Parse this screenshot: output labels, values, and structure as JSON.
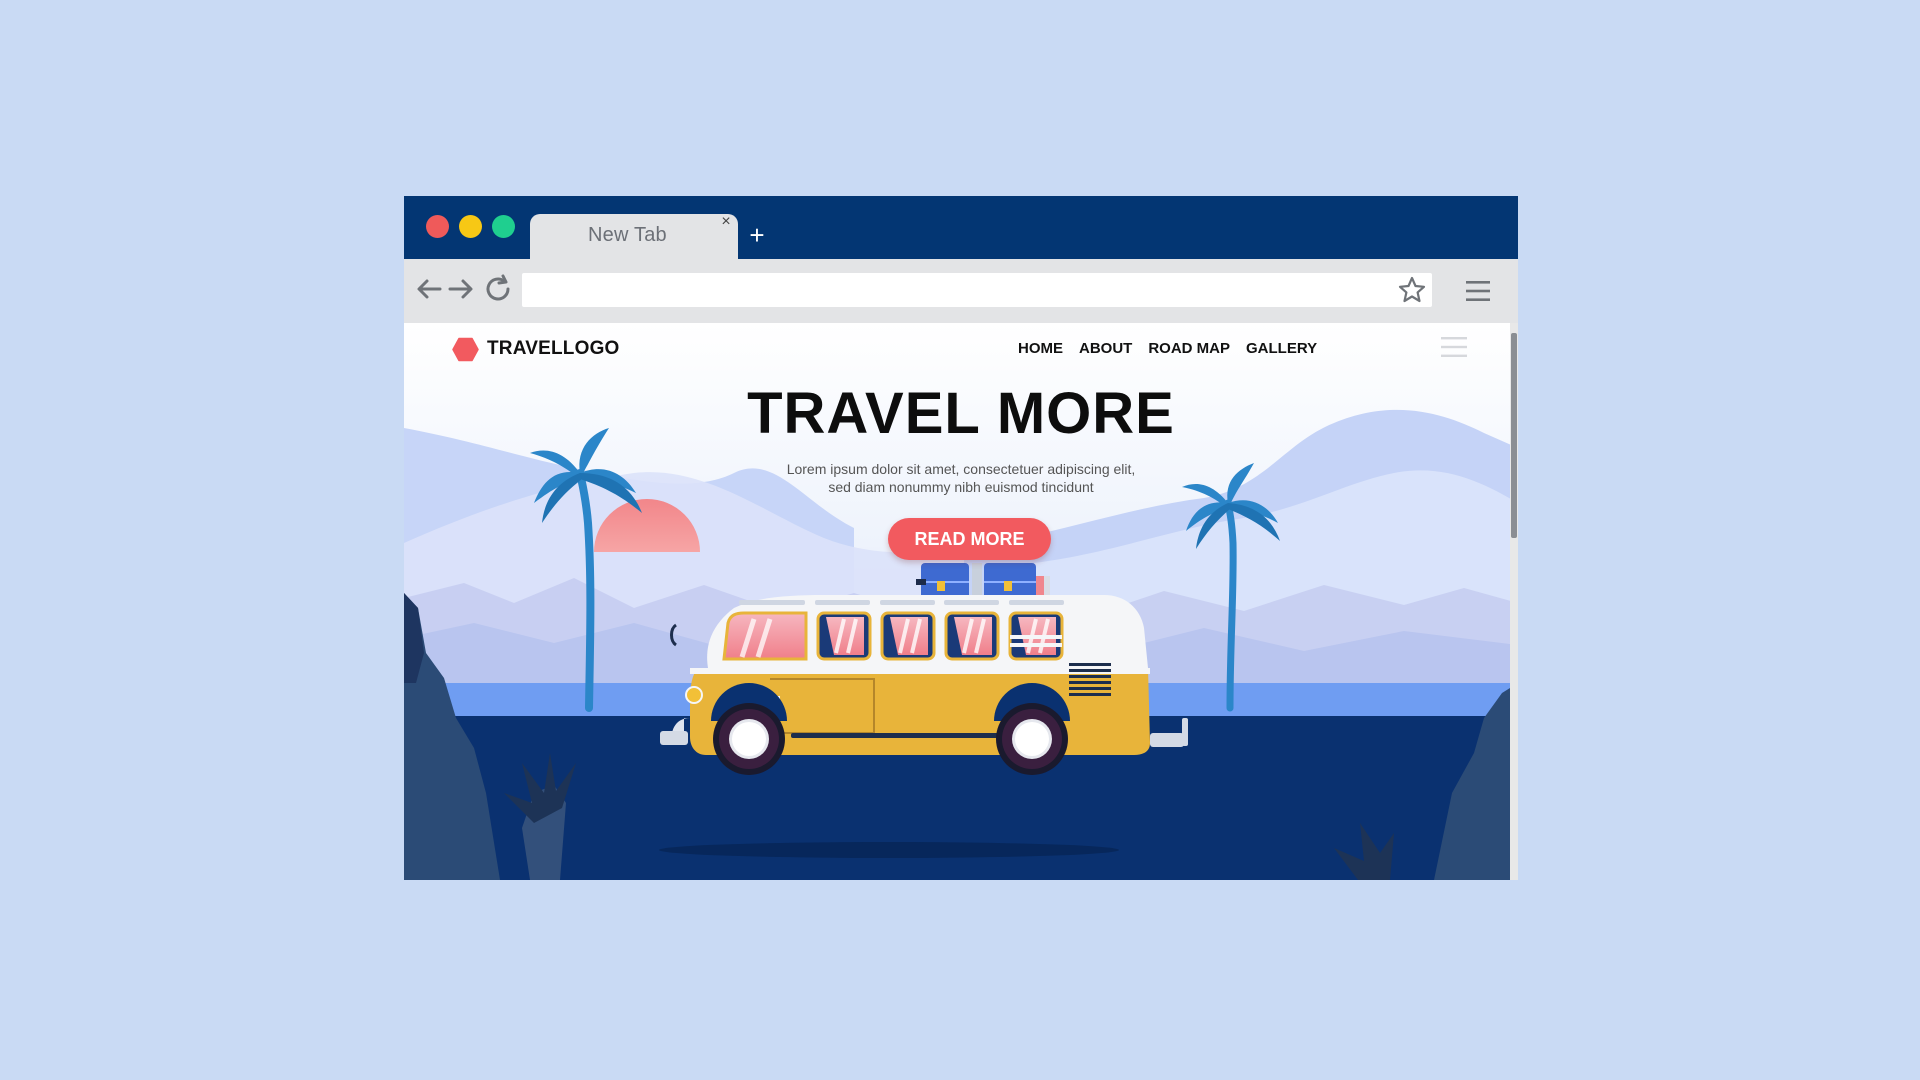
{
  "browser": {
    "tab_title": "New Tab",
    "tab_close": "×",
    "new_tab": "+",
    "address_value": "",
    "colors": {
      "titlebar": "#033673",
      "traffic_red": "#ef5a5a",
      "traffic_yellow": "#f7c815",
      "traffic_green": "#1fcf8f"
    }
  },
  "site": {
    "logo_text": "TRAVELLOGO",
    "logo_color": "#f25a5f",
    "nav": [
      "HOME",
      "ABOUT",
      "ROAD MAP",
      "GALLERY"
    ],
    "headline": "TRAVEL MORE",
    "subtitle_lines": [
      "Lorem ipsum dolor sit amet, consectetuer adipiscing elit,",
      "sed diam nonummy nibh euismod tincidunt"
    ],
    "cta_label": "READ MORE",
    "cta_color": "#f25a5f"
  },
  "icons": [
    "back-arrow-icon",
    "forward-arrow-icon",
    "reload-icon",
    "bookmark-star-icon",
    "browser-menu-icon",
    "site-menu-icon",
    "logo-hexagon-icon"
  ]
}
